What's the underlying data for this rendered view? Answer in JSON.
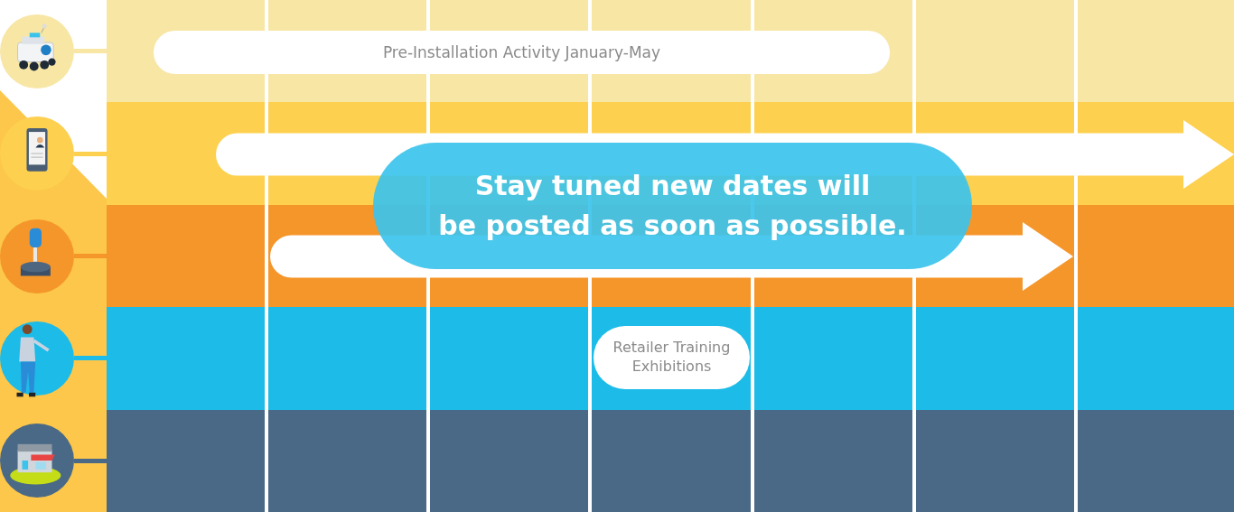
{
  "rows": [
    {
      "color": "#f8e6a5",
      "bar": {
        "kind": "pill",
        "label": "Pre-Installation Activity January-May"
      }
    },
    {
      "color": "#fdd04f",
      "bar": {
        "kind": "arrow"
      }
    },
    {
      "color": "#f5962b",
      "bar": {
        "kind": "arrow"
      }
    },
    {
      "color": "#1cbbe8",
      "bar": {
        "kind": "pill",
        "label": "Retailer Training Exhibitions"
      }
    },
    {
      "color": "#4a6987"
    }
  ],
  "notice": {
    "text": "Stay tuned new dates will\nbe posted as soon as possible."
  }
}
